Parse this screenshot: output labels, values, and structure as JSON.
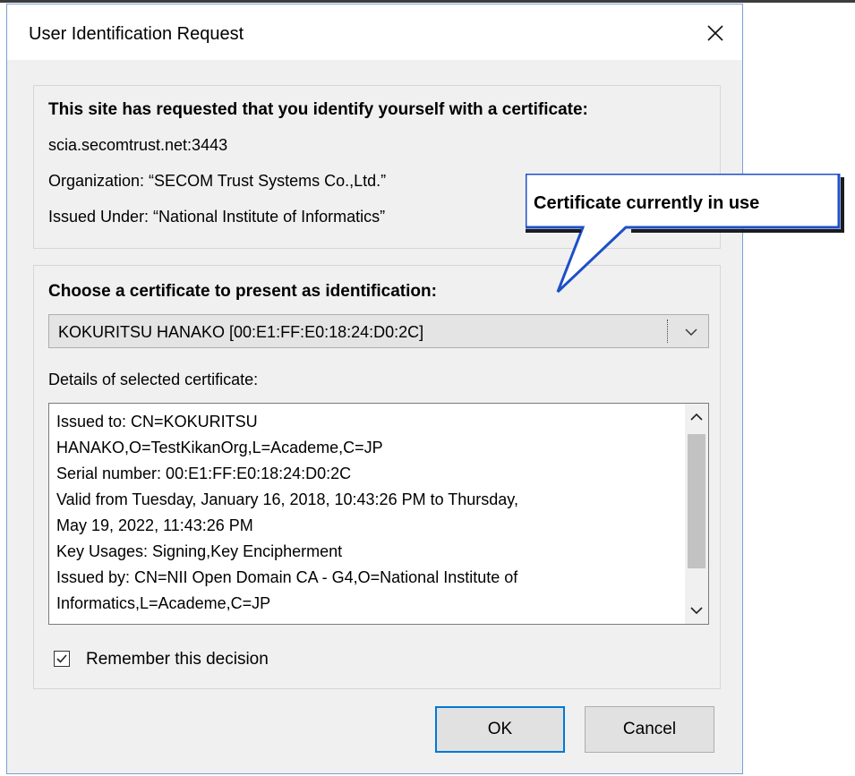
{
  "dialog": {
    "title": "User Identification Request",
    "close_icon": "close-icon"
  },
  "site_info": {
    "heading": "This site has requested that you identify yourself with a certificate:",
    "host": "scia.secomtrust.net:3443",
    "organization": "Organization: “SECOM Trust Systems Co.,Ltd.”",
    "issued_under": "Issued Under: “National Institute of Informatics”"
  },
  "certificate": {
    "heading": "Choose a certificate to present as identification:",
    "selected": "KOKURITSU HANAKO [00:E1:FF:E0:18:24:D0:2C]",
    "details_label": "Details of selected certificate:",
    "details_lines": [
      "Issued to: CN=KOKURITSU",
      "HANAKO,O=TestKikanOrg,L=Academe,C=JP",
      "Serial number: 00:E1:FF:E0:18:24:D0:2C",
      "Valid from Tuesday, January 16, 2018, 10:43:26 PM to Thursday,",
      "May 19, 2022, 11:43:26 PM",
      "Key Usages: Signing,Key Encipherment",
      "Issued by: CN=NII Open Domain CA - G4,O=National Institute of",
      "Informatics,L=Academe,C=JP"
    ],
    "remember_label": "Remember this decision",
    "remember_checked": true
  },
  "buttons": {
    "ok": "OK",
    "cancel": "Cancel"
  },
  "callout": {
    "text": "Certificate currently in use",
    "color": "#1e4fc8"
  }
}
